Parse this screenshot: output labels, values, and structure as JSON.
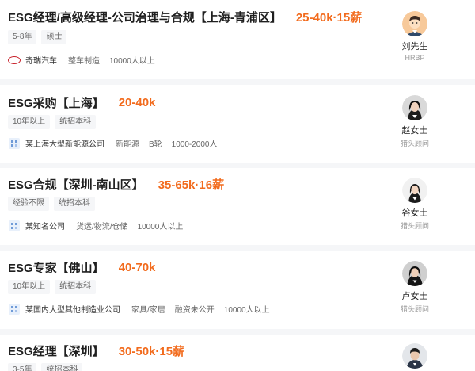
{
  "jobs": [
    {
      "title": "ESG经理/高级经理-公司治理与合规【上海-青浦区】",
      "salary": "25-40k·15薪",
      "tags": [
        "5-8年",
        "硕士"
      ],
      "company": {
        "logo": "chery-logo",
        "name": "奇瑞汽车",
        "meta": [
          "整车制造",
          "10000人以上"
        ]
      },
      "recruiter": {
        "name": "刘先生",
        "role": "HRBP",
        "avatar": "male-cartoon-avatar"
      }
    },
    {
      "title": "ESG采购【上海】",
      "salary": "20-40k",
      "tags": [
        "10年以上",
        "统招本科"
      ],
      "company": {
        "logo": "generic-company-logo",
        "name": "某上海大型新能源公司",
        "meta": [
          "新能源",
          "B轮",
          "1000-2000人"
        ]
      },
      "recruiter": {
        "name": "赵女士",
        "role": "猎头顾问",
        "avatar": "female-photo-avatar"
      }
    },
    {
      "title": "ESG合规【深圳-南山区】",
      "salary": "35-65k·16薪",
      "tags": [
        "经验不限",
        "统招本科"
      ],
      "company": {
        "logo": "generic-company-logo",
        "name": "某知名公司",
        "meta": [
          "货运/物流/仓储",
          "10000人以上"
        ]
      },
      "recruiter": {
        "name": "谷女士",
        "role": "猎头顾问",
        "avatar": "female-photo-avatar"
      }
    },
    {
      "title": "ESG专家【佛山】",
      "salary": "40-70k",
      "tags": [
        "10年以上",
        "统招本科"
      ],
      "company": {
        "logo": "generic-company-logo",
        "name": "某国内大型其他制造业公司",
        "meta": [
          "家具/家居",
          "融资未公开",
          "10000人以上"
        ]
      },
      "recruiter": {
        "name": "卢女士",
        "role": "猎头顾问",
        "avatar": "female-photo-avatar"
      }
    },
    {
      "title": "ESG经理【深圳】",
      "salary": "30-50k·15薪",
      "tags": [
        "3-5年",
        "统招本科"
      ],
      "company": {
        "logo": "generic-company-logo",
        "name": "",
        "meta": []
      },
      "recruiter": {
        "name": "",
        "role": "",
        "avatar": "male-photo-avatar"
      }
    }
  ],
  "colors": {
    "salary": "#f26b1d",
    "background": "#f5f6f8",
    "card": "#ffffff"
  }
}
